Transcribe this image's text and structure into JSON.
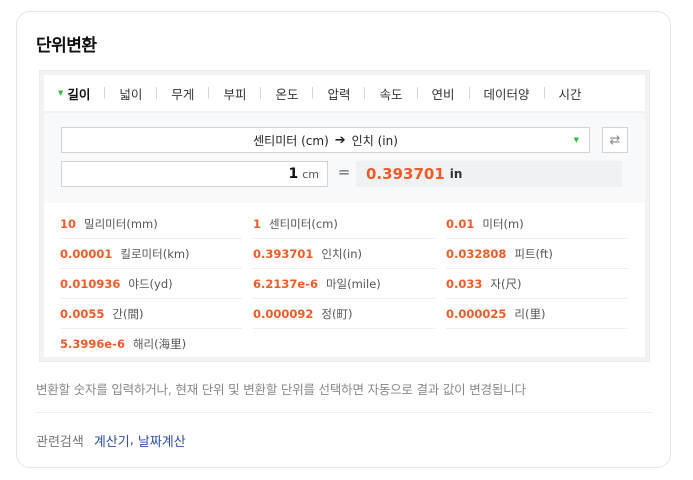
{
  "card": {
    "title": "단위변환"
  },
  "tabs": [
    {
      "label": "길이",
      "active": true
    },
    {
      "label": "넓이"
    },
    {
      "label": "무게"
    },
    {
      "label": "부피"
    },
    {
      "label": "온도"
    },
    {
      "label": "압력"
    },
    {
      "label": "속도"
    },
    {
      "label": "연비"
    },
    {
      "label": "데이터양"
    },
    {
      "label": "시간"
    }
  ],
  "converter": {
    "from_unit": "센티미터 (cm)",
    "arrow": "➔",
    "to_unit": "인치 (in)",
    "input_value": "1",
    "input_unit": "cm",
    "equals": "=",
    "result_value": "0.393701",
    "result_unit": "in"
  },
  "results": [
    [
      {
        "value": "10",
        "unit": "밀리미터(mm)"
      },
      {
        "value": "1",
        "unit": "센티미터(cm)"
      },
      {
        "value": "0.01",
        "unit": "미터(m)"
      }
    ],
    [
      {
        "value": "0.00001",
        "unit": "킬로미터(km)"
      },
      {
        "value": "0.393701",
        "unit": "인치(in)"
      },
      {
        "value": "0.032808",
        "unit": "피트(ft)"
      }
    ],
    [
      {
        "value": "0.010936",
        "unit": "야드(yd)"
      },
      {
        "value": "6.2137e-6",
        "unit": "마일(mile)"
      },
      {
        "value": "0.033",
        "unit": "자(尺)"
      }
    ],
    [
      {
        "value": "0.0055",
        "unit": "간(間)"
      },
      {
        "value": "0.000092",
        "unit": "정(町)"
      },
      {
        "value": "0.000025",
        "unit": "리(里)"
      }
    ],
    [
      {
        "value": "5.3996e-6",
        "unit": "해리(海里)"
      }
    ]
  ],
  "hint": "변환할 숫자를 입력하거나, 현재 단위 및 변환할 단위를 선택하면 자동으로 결과 값이 변경됩니다",
  "related": {
    "label": "관련검색",
    "links": [
      "계산기",
      "날짜계산"
    ]
  },
  "colors": {
    "accent": "#ee5b29",
    "caret": "#2ac140",
    "link": "#2e4fa3"
  }
}
